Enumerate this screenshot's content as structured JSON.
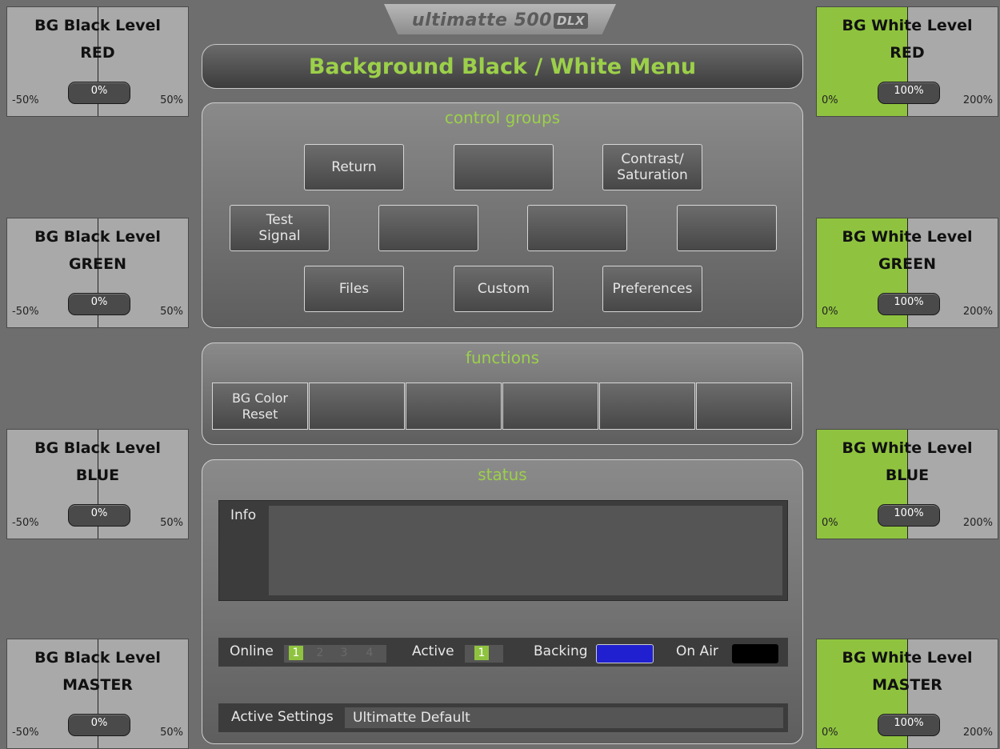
{
  "logo": {
    "text": "ultimatte 500",
    "badge": "DLX"
  },
  "menu_title": "Background Black / White Menu",
  "left_knobs": [
    {
      "title": "BG Black Level",
      "channel": "RED",
      "value": "0%",
      "min": "-50%",
      "max": "50%"
    },
    {
      "title": "BG Black Level",
      "channel": "GREEN",
      "value": "0%",
      "min": "-50%",
      "max": "50%"
    },
    {
      "title": "BG Black Level",
      "channel": "BLUE",
      "value": "0%",
      "min": "-50%",
      "max": "50%"
    },
    {
      "title": "BG Black Level",
      "channel": "MASTER",
      "value": "0%",
      "min": "-50%",
      "max": "50%"
    }
  ],
  "right_knobs": [
    {
      "title": "BG White Level",
      "channel": "RED",
      "value": "100%",
      "min": "0%",
      "max": "200%"
    },
    {
      "title": "BG White Level",
      "channel": "GREEN",
      "value": "100%",
      "min": "0%",
      "max": "200%"
    },
    {
      "title": "BG White Level",
      "channel": "BLUE",
      "value": "100%",
      "min": "0%",
      "max": "200%"
    },
    {
      "title": "BG White Level",
      "channel": "MASTER",
      "value": "100%",
      "min": "0%",
      "max": "200%"
    }
  ],
  "control_groups": {
    "title": "control groups",
    "buttons": [
      "Return",
      "",
      "Contrast/\nSaturation",
      "Test\nSignal",
      "",
      "",
      "",
      "Files",
      "Custom",
      "Preferences"
    ]
  },
  "functions": {
    "title": "functions",
    "buttons": [
      "BG Color\nReset",
      "",
      "",
      "",
      "",
      ""
    ]
  },
  "status": {
    "title": "status",
    "info_label": "Info",
    "online_label": "Online",
    "online_units": [
      "1",
      "2",
      "3",
      "4"
    ],
    "active_label": "Active",
    "active_value": "1",
    "backing_label": "Backing",
    "backing_color": "#2020d0",
    "onair_label": "On Air",
    "onair_color": "#000000",
    "settings_label": "Active Settings",
    "settings_value": "Ultimatte Default"
  },
  "colors": {
    "accent_green": "#9cd04a",
    "indicator_green": "#8fc33f"
  }
}
